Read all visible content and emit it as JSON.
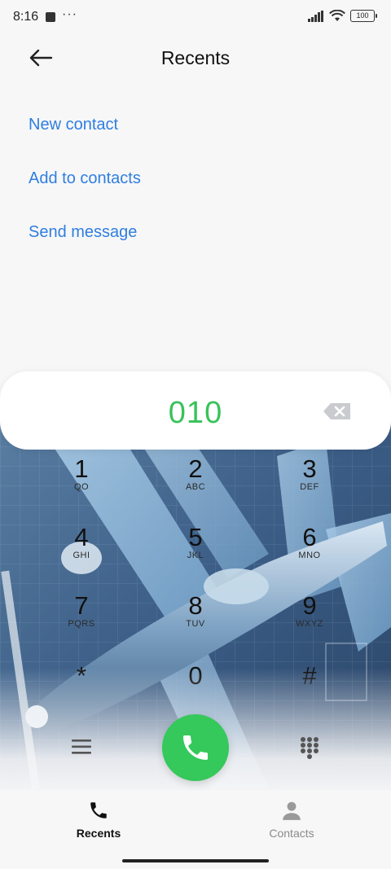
{
  "status": {
    "time": "8:16",
    "more": "···",
    "battery": "100"
  },
  "header": {
    "title": "Recents"
  },
  "menu": [
    {
      "label": "New contact"
    },
    {
      "label": "Add to contacts"
    },
    {
      "label": "Send message"
    }
  ],
  "dialer": {
    "number": "010",
    "keys": [
      {
        "digit": "1",
        "letters": "QO"
      },
      {
        "digit": "2",
        "letters": "ABC"
      },
      {
        "digit": "3",
        "letters": "DEF"
      },
      {
        "digit": "4",
        "letters": "GHI"
      },
      {
        "digit": "5",
        "letters": "JKL"
      },
      {
        "digit": "6",
        "letters": "MNO"
      },
      {
        "digit": "7",
        "letters": "PQRS"
      },
      {
        "digit": "8",
        "letters": "TUV"
      },
      {
        "digit": "9",
        "letters": "WXYZ"
      },
      {
        "digit": "*",
        "letters": ""
      },
      {
        "digit": "0",
        "letters": ""
      },
      {
        "digit": "#",
        "letters": ""
      }
    ]
  },
  "tabs": [
    {
      "label": "Recents",
      "icon": "phone-icon",
      "active": true
    },
    {
      "label": "Contacts",
      "icon": "person-icon",
      "active": false
    }
  ],
  "colors": {
    "accent_link": "#2f7ee0",
    "call_green": "#35c85a",
    "number_green": "#38c25a"
  }
}
